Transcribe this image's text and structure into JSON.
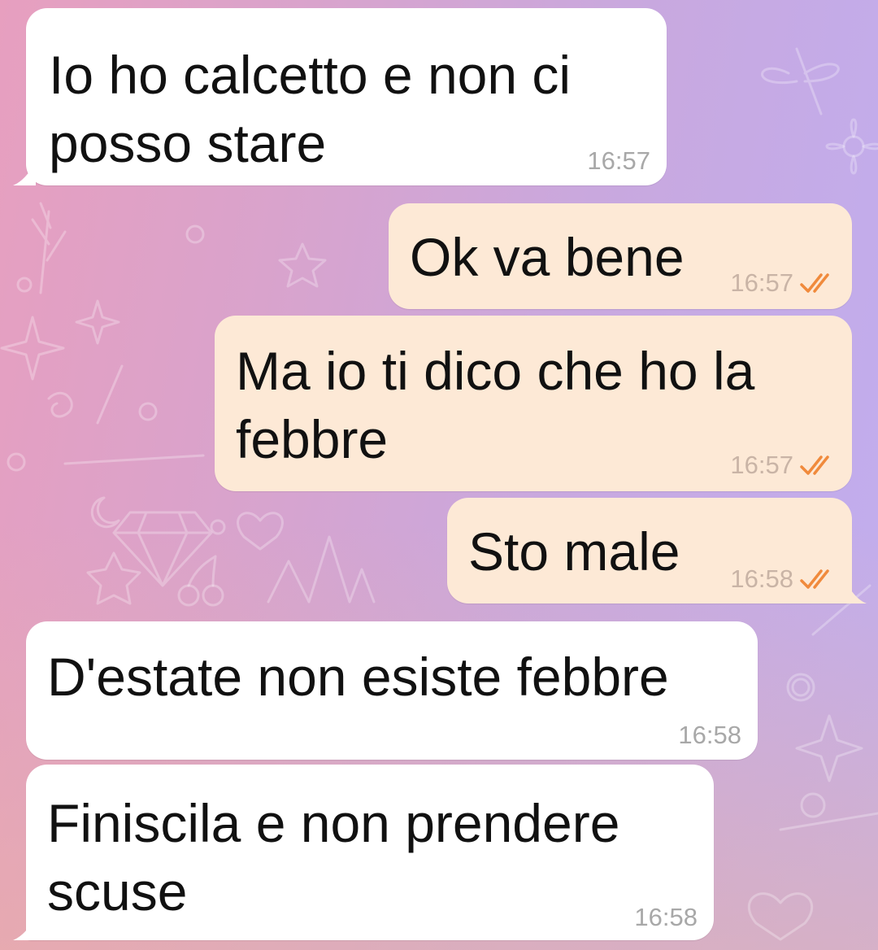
{
  "theme": {
    "incoming_bubble": "#ffffff",
    "outgoing_bubble": "#fde9d6",
    "read_check_color": "#f08a3c"
  },
  "messages": [
    {
      "direction": "incoming",
      "text": "Io ho calcetto e non ci\nposso stare",
      "time": "16:57"
    },
    {
      "direction": "outgoing",
      "text": "Ok va bene",
      "time": "16:57",
      "status": "read",
      "status_icon": "double-check-icon"
    },
    {
      "direction": "outgoing",
      "text": "Ma io ti dico che ho la\nfebbre",
      "time": "16:57",
      "status": "read",
      "status_icon": "double-check-icon"
    },
    {
      "direction": "outgoing",
      "text": "Sto male",
      "time": "16:58",
      "status": "read",
      "status_icon": "double-check-icon"
    },
    {
      "direction": "incoming",
      "text": "D'estate non esiste febbre",
      "time": "16:58"
    },
    {
      "direction": "incoming",
      "text": "Finiscila e non prendere\nscuse",
      "time": "16:58"
    }
  ]
}
